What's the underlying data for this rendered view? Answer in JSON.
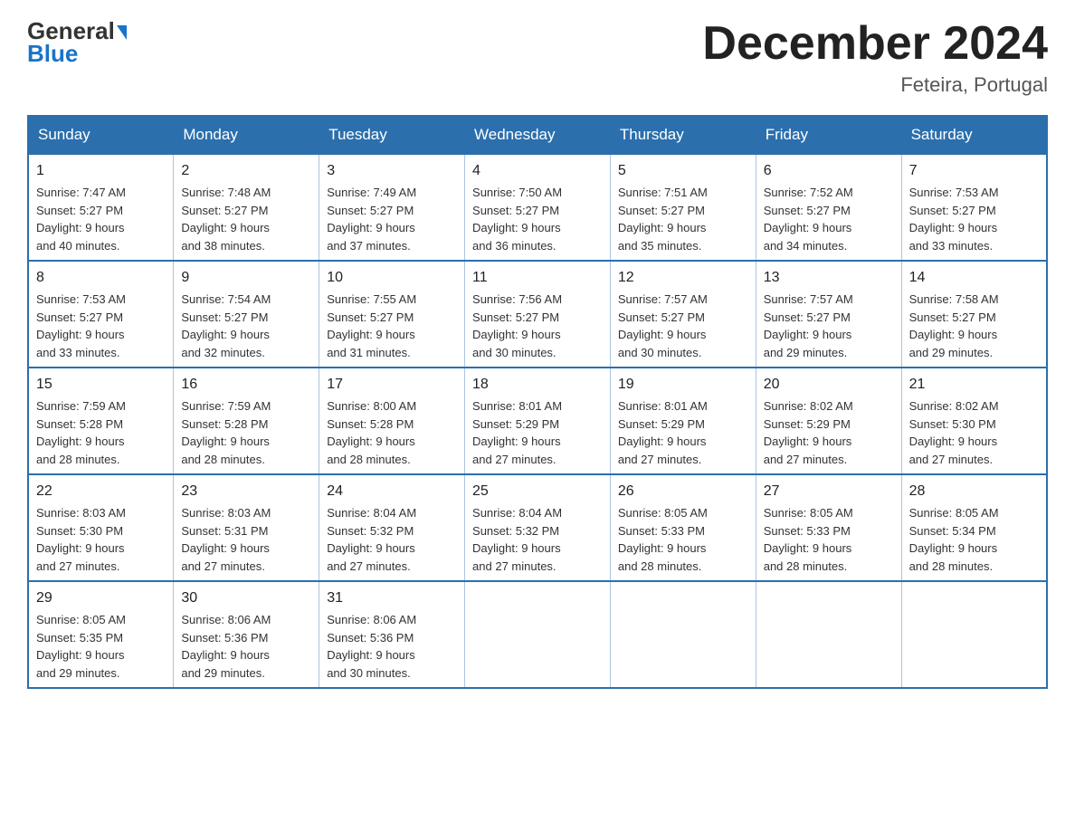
{
  "logo": {
    "name": "General",
    "name2": "Blue"
  },
  "title": "December 2024",
  "subtitle": "Feteira, Portugal",
  "days_of_week": [
    "Sunday",
    "Monday",
    "Tuesday",
    "Wednesday",
    "Thursday",
    "Friday",
    "Saturday"
  ],
  "weeks": [
    [
      {
        "day": "1",
        "sunrise": "7:47 AM",
        "sunset": "5:27 PM",
        "daylight": "9 hours and 40 minutes."
      },
      {
        "day": "2",
        "sunrise": "7:48 AM",
        "sunset": "5:27 PM",
        "daylight": "9 hours and 38 minutes."
      },
      {
        "day": "3",
        "sunrise": "7:49 AM",
        "sunset": "5:27 PM",
        "daylight": "9 hours and 37 minutes."
      },
      {
        "day": "4",
        "sunrise": "7:50 AM",
        "sunset": "5:27 PM",
        "daylight": "9 hours and 36 minutes."
      },
      {
        "day": "5",
        "sunrise": "7:51 AM",
        "sunset": "5:27 PM",
        "daylight": "9 hours and 35 minutes."
      },
      {
        "day": "6",
        "sunrise": "7:52 AM",
        "sunset": "5:27 PM",
        "daylight": "9 hours and 34 minutes."
      },
      {
        "day": "7",
        "sunrise": "7:53 AM",
        "sunset": "5:27 PM",
        "daylight": "9 hours and 33 minutes."
      }
    ],
    [
      {
        "day": "8",
        "sunrise": "7:53 AM",
        "sunset": "5:27 PM",
        "daylight": "9 hours and 33 minutes."
      },
      {
        "day": "9",
        "sunrise": "7:54 AM",
        "sunset": "5:27 PM",
        "daylight": "9 hours and 32 minutes."
      },
      {
        "day": "10",
        "sunrise": "7:55 AM",
        "sunset": "5:27 PM",
        "daylight": "9 hours and 31 minutes."
      },
      {
        "day": "11",
        "sunrise": "7:56 AM",
        "sunset": "5:27 PM",
        "daylight": "9 hours and 30 minutes."
      },
      {
        "day": "12",
        "sunrise": "7:57 AM",
        "sunset": "5:27 PM",
        "daylight": "9 hours and 30 minutes."
      },
      {
        "day": "13",
        "sunrise": "7:57 AM",
        "sunset": "5:27 PM",
        "daylight": "9 hours and 29 minutes."
      },
      {
        "day": "14",
        "sunrise": "7:58 AM",
        "sunset": "5:27 PM",
        "daylight": "9 hours and 29 minutes."
      }
    ],
    [
      {
        "day": "15",
        "sunrise": "7:59 AM",
        "sunset": "5:28 PM",
        "daylight": "9 hours and 28 minutes."
      },
      {
        "day": "16",
        "sunrise": "7:59 AM",
        "sunset": "5:28 PM",
        "daylight": "9 hours and 28 minutes."
      },
      {
        "day": "17",
        "sunrise": "8:00 AM",
        "sunset": "5:28 PM",
        "daylight": "9 hours and 28 minutes."
      },
      {
        "day": "18",
        "sunrise": "8:01 AM",
        "sunset": "5:29 PM",
        "daylight": "9 hours and 27 minutes."
      },
      {
        "day": "19",
        "sunrise": "8:01 AM",
        "sunset": "5:29 PM",
        "daylight": "9 hours and 27 minutes."
      },
      {
        "day": "20",
        "sunrise": "8:02 AM",
        "sunset": "5:29 PM",
        "daylight": "9 hours and 27 minutes."
      },
      {
        "day": "21",
        "sunrise": "8:02 AM",
        "sunset": "5:30 PM",
        "daylight": "9 hours and 27 minutes."
      }
    ],
    [
      {
        "day": "22",
        "sunrise": "8:03 AM",
        "sunset": "5:30 PM",
        "daylight": "9 hours and 27 minutes."
      },
      {
        "day": "23",
        "sunrise": "8:03 AM",
        "sunset": "5:31 PM",
        "daylight": "9 hours and 27 minutes."
      },
      {
        "day": "24",
        "sunrise": "8:04 AM",
        "sunset": "5:32 PM",
        "daylight": "9 hours and 27 minutes."
      },
      {
        "day": "25",
        "sunrise": "8:04 AM",
        "sunset": "5:32 PM",
        "daylight": "9 hours and 27 minutes."
      },
      {
        "day": "26",
        "sunrise": "8:05 AM",
        "sunset": "5:33 PM",
        "daylight": "9 hours and 28 minutes."
      },
      {
        "day": "27",
        "sunrise": "8:05 AM",
        "sunset": "5:33 PM",
        "daylight": "9 hours and 28 minutes."
      },
      {
        "day": "28",
        "sunrise": "8:05 AM",
        "sunset": "5:34 PM",
        "daylight": "9 hours and 28 minutes."
      }
    ],
    [
      {
        "day": "29",
        "sunrise": "8:05 AM",
        "sunset": "5:35 PM",
        "daylight": "9 hours and 29 minutes."
      },
      {
        "day": "30",
        "sunrise": "8:06 AM",
        "sunset": "5:36 PM",
        "daylight": "9 hours and 29 minutes."
      },
      {
        "day": "31",
        "sunrise": "8:06 AM",
        "sunset": "5:36 PM",
        "daylight": "9 hours and 30 minutes."
      },
      null,
      null,
      null,
      null
    ]
  ],
  "labels": {
    "sunrise": "Sunrise:",
    "sunset": "Sunset:",
    "daylight": "Daylight:"
  }
}
